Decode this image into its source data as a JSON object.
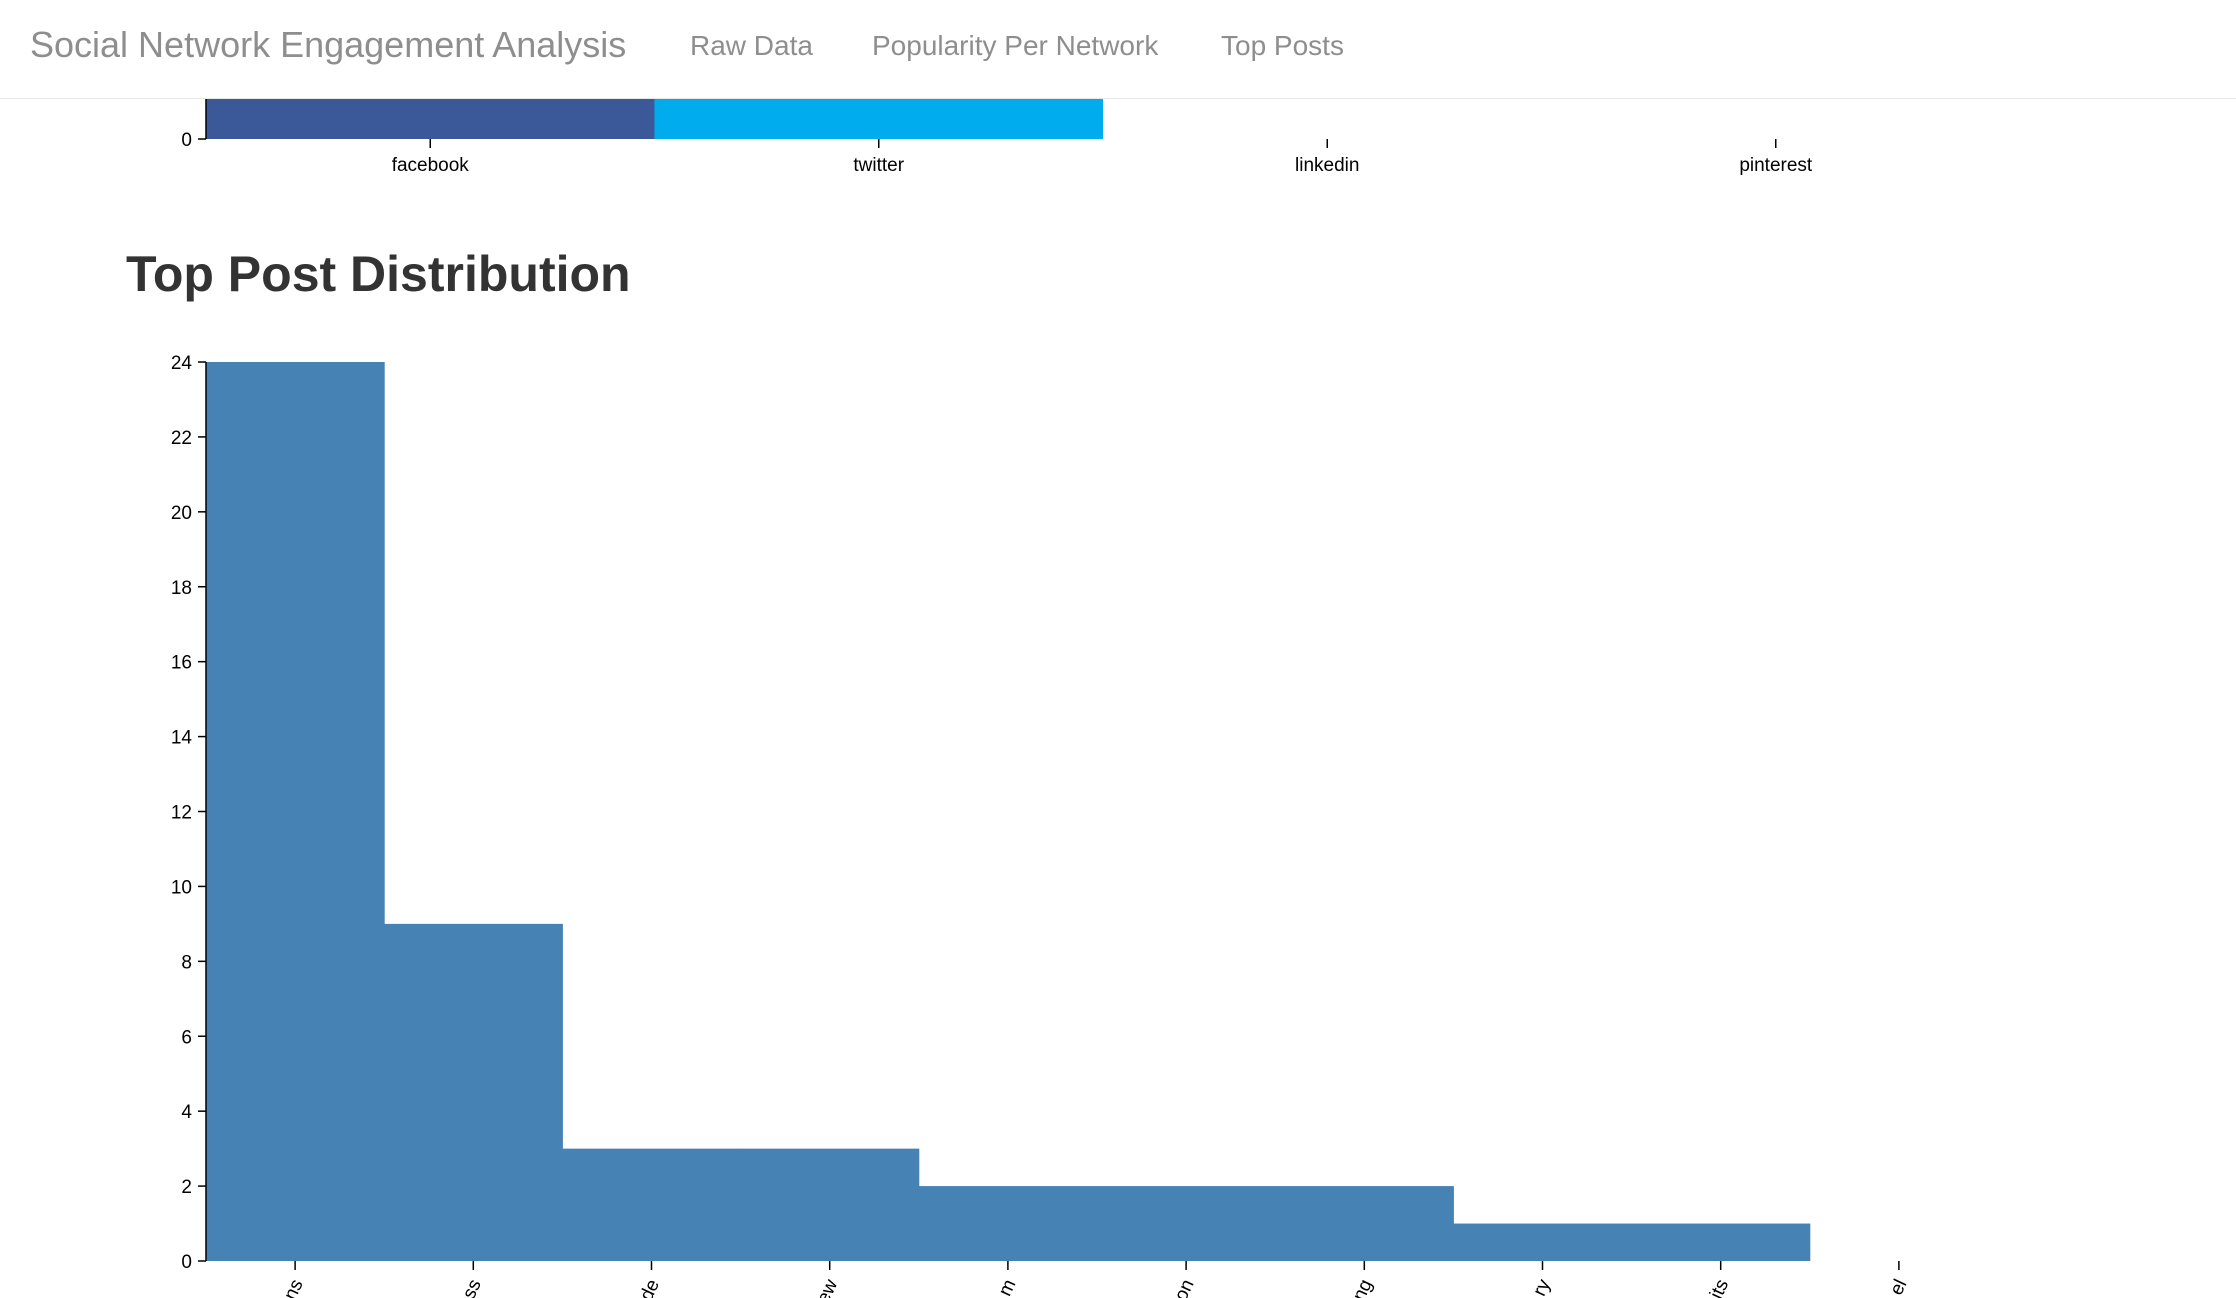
{
  "navbar": {
    "brand": "Social Network Engagement Analysis",
    "links": [
      {
        "label": "Raw Data"
      },
      {
        "label": "Popularity Per Network"
      },
      {
        "label": "Top Posts"
      }
    ]
  },
  "sections": {
    "top_post_title": "Top Post Distribution"
  },
  "chart_data": [
    {
      "type": "bar",
      "categories": [
        "facebook",
        "twitter",
        "linkedin",
        "pinterest"
      ],
      "values": [
        null,
        null,
        null,
        null
      ],
      "colors": [
        "#3b5998",
        "#00acee",
        "#0e76a8",
        "#cb2027"
      ],
      "yticks_visible": [
        "0"
      ],
      "note_visible": "only the bottom of the chart is visible; bars extend above the visible area"
    },
    {
      "type": "bar",
      "title": "Top Post Distribution",
      "categories": [
        "ns",
        "ss",
        "de",
        "ew",
        "m",
        "on",
        "ng",
        "ry",
        "its",
        "el"
      ],
      "values": [
        24,
        9,
        3,
        3,
        2,
        2,
        2,
        1,
        1,
        0
      ],
      "color": "#4682b4",
      "ylim": [
        0,
        24
      ],
      "yticks": [
        0,
        2,
        4,
        6,
        8,
        10,
        12,
        14,
        16,
        18,
        20,
        22,
        24
      ]
    }
  ]
}
